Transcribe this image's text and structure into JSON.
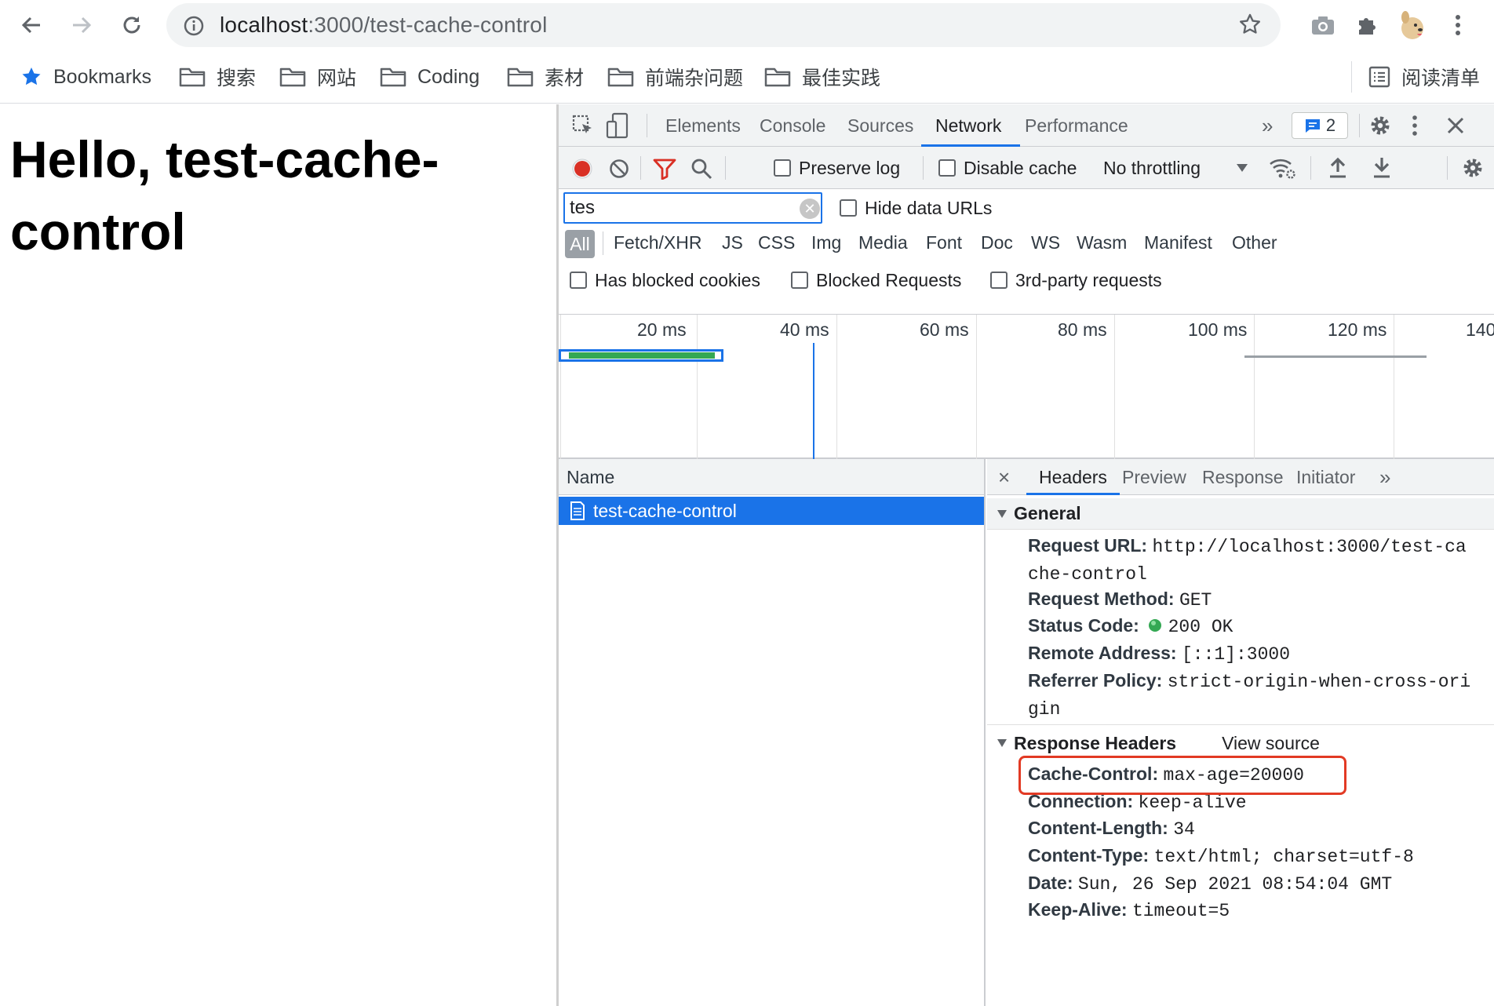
{
  "browser": {
    "url_host": "localhost",
    "url_path": ":3000/test-cache-control",
    "bookmarks": [
      {
        "label": "Bookmarks",
        "icon": "star-icon"
      },
      {
        "label": "搜索",
        "icon": "folder-icon"
      },
      {
        "label": "网站",
        "icon": "folder-icon"
      },
      {
        "label": "Coding",
        "icon": "folder-icon"
      },
      {
        "label": "素材",
        "icon": "folder-icon"
      },
      {
        "label": "前端杂问题",
        "icon": "folder-icon"
      },
      {
        "label": "最佳实践",
        "icon": "folder-icon"
      }
    ],
    "reading_list": "阅读清单"
  },
  "page": {
    "heading": "Hello, test-cache-control"
  },
  "devtools": {
    "tabs": [
      "Elements",
      "Console",
      "Sources",
      "Network",
      "Performance"
    ],
    "active_tab": "Network",
    "more_tabs": "»",
    "issues_count": "2",
    "network": {
      "preserve_log": "Preserve log",
      "disable_cache": "Disable cache",
      "throttling": "No throttling",
      "filter_value": "tes",
      "hide_data_urls": "Hide data URLs",
      "types": [
        "All",
        "Fetch/XHR",
        "JS",
        "CSS",
        "Img",
        "Media",
        "Font",
        "Doc",
        "WS",
        "Wasm",
        "Manifest",
        "Other"
      ],
      "active_type": "All",
      "blocked_cookies": "Has blocked cookies",
      "blocked_requests": "Blocked Requests",
      "third_party": "3rd-party requests",
      "timeline_ticks": [
        "20 ms",
        "40 ms",
        "60 ms",
        "80 ms",
        "100 ms",
        "120 ms",
        "140"
      ],
      "name_header": "Name",
      "request_name": "test-cache-control"
    },
    "details": {
      "close": "×",
      "tabs": [
        "Headers",
        "Preview",
        "Response",
        "Initiator"
      ],
      "active_tab": "Headers",
      "more": "»",
      "general_title": "General",
      "request_url_key": "Request URL:",
      "request_url_val_1": "http://localhost:3000/test-ca",
      "request_url_val_2": "che-control",
      "method_key": "Request Method:",
      "method_val": "GET",
      "status_key": "Status Code:",
      "status_val": "200 OK",
      "remote_key": "Remote Address:",
      "remote_val": "[::1]:3000",
      "referrer_key": "Referrer Policy:",
      "referrer_val_1": "strict-origin-when-cross-ori",
      "referrer_val_2": "gin",
      "response_title": "Response Headers",
      "view_source": "View source",
      "cache_key": "Cache-Control:",
      "cache_val": "max-age=20000",
      "connection_key": "Connection:",
      "connection_val": "keep-alive",
      "length_key": "Content-Length:",
      "length_val": "34",
      "type_key": "Content-Type:",
      "type_val": "text/html; charset=utf-8",
      "date_key": "Date:",
      "date_val": "Sun, 26 Sep 2021 08:54:04 GMT",
      "keepalive_key": "Keep-Alive:",
      "keepalive_val": "timeout=5"
    }
  },
  "colors": {
    "accent": "#1a73e8",
    "record": "#d93025",
    "highlight": "#e23a24",
    "status_ok": "#34a853"
  }
}
